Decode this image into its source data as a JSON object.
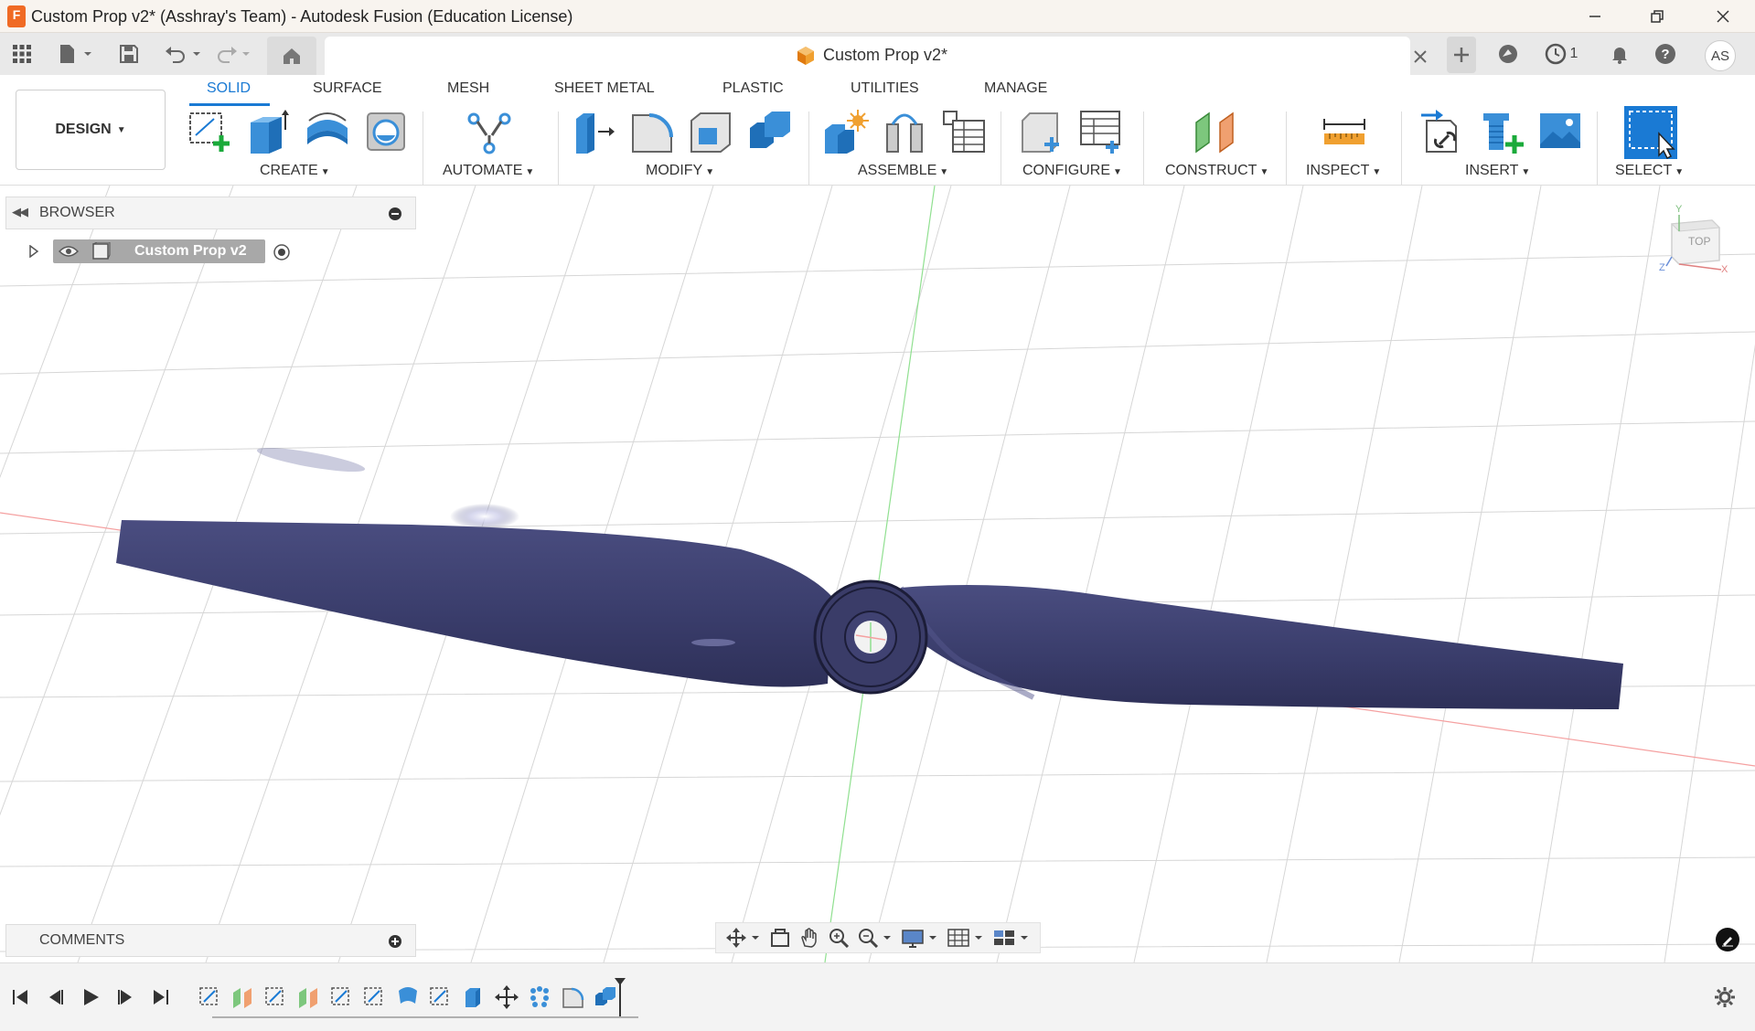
{
  "titlebar": {
    "title": "Custom Prop v2* (Asshray's Team) - Autodesk Fusion (Education License)",
    "app_icon_letter": "F",
    "buttons": [
      "minimize-icon",
      "restore-icon",
      "close-icon"
    ]
  },
  "tabbar": {
    "doc_tab_title": "Custom Prop v2*",
    "jobs_count": "1",
    "avatar_initials": "AS"
  },
  "ribbon": {
    "workspace": "DESIGN",
    "tabs": [
      "SOLID",
      "SURFACE",
      "MESH",
      "SHEET METAL",
      "PLASTIC",
      "UTILITIES",
      "MANAGE"
    ],
    "active_tab": "SOLID",
    "groups": [
      "CREATE",
      "AUTOMATE",
      "MODIFY",
      "ASSEMBLE",
      "CONFIGURE",
      "CONSTRUCT",
      "INSPECT",
      "INSERT",
      "SELECT"
    ]
  },
  "browser": {
    "title": "BROWSER",
    "root_node": "Custom Prop v2"
  },
  "comments": {
    "title": "COMMENTS"
  },
  "viewcube": {
    "face": "TOP",
    "axis_x": "X",
    "axis_y": "Y",
    "axis_z": "Z"
  },
  "colors": {
    "accent": "#1a7ad4",
    "propeller": "#3b3d6b",
    "grid": "#d6d6d6",
    "x_axis": "#f08080",
    "y_axis": "#90e090"
  }
}
